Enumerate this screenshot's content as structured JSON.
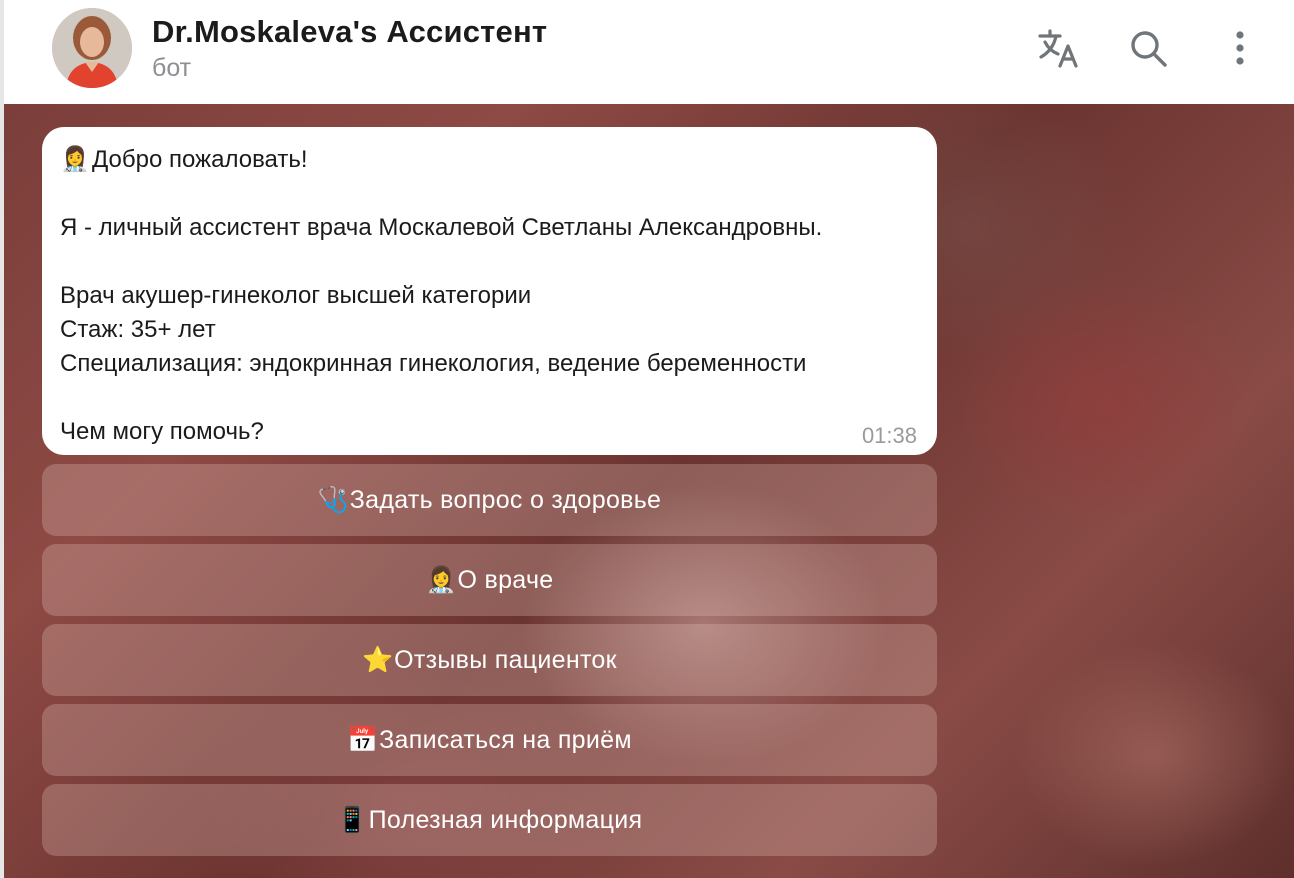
{
  "header": {
    "title": "Dr.Moskaleva's Ассистент",
    "subtitle": "бот",
    "icons": [
      "translate-icon",
      "search-icon",
      "more-vert-icon"
    ]
  },
  "message": {
    "lines": [
      "Добро пожаловать!",
      "",
      "Я - личный ассистент врача Москалевой Светланы Александровны.",
      "",
      "Врач акушер-гинеколог высшей категории",
      "Стаж: 35+ лет",
      "Специализация: эндокринная гинекология, ведение беременности",
      "",
      "Чем могу помочь?"
    ],
    "lead_emoji": "👩‍⚕️",
    "time": "01:38"
  },
  "keyboard": [
    {
      "emoji": "🩺",
      "label": "Задать вопрос о здоровье"
    },
    {
      "emoji": "👩‍⚕️",
      "label": "О враче"
    },
    {
      "emoji": "⭐",
      "label": "Отзывы пациенток"
    },
    {
      "emoji": "📅",
      "label": "Записаться на приём"
    },
    {
      "emoji": "📱",
      "label": "Полезная информация"
    }
  ],
  "colors": {
    "bubble_bg": "#ffffff",
    "subtitle": "#8e8e93",
    "icon": "#707579"
  }
}
